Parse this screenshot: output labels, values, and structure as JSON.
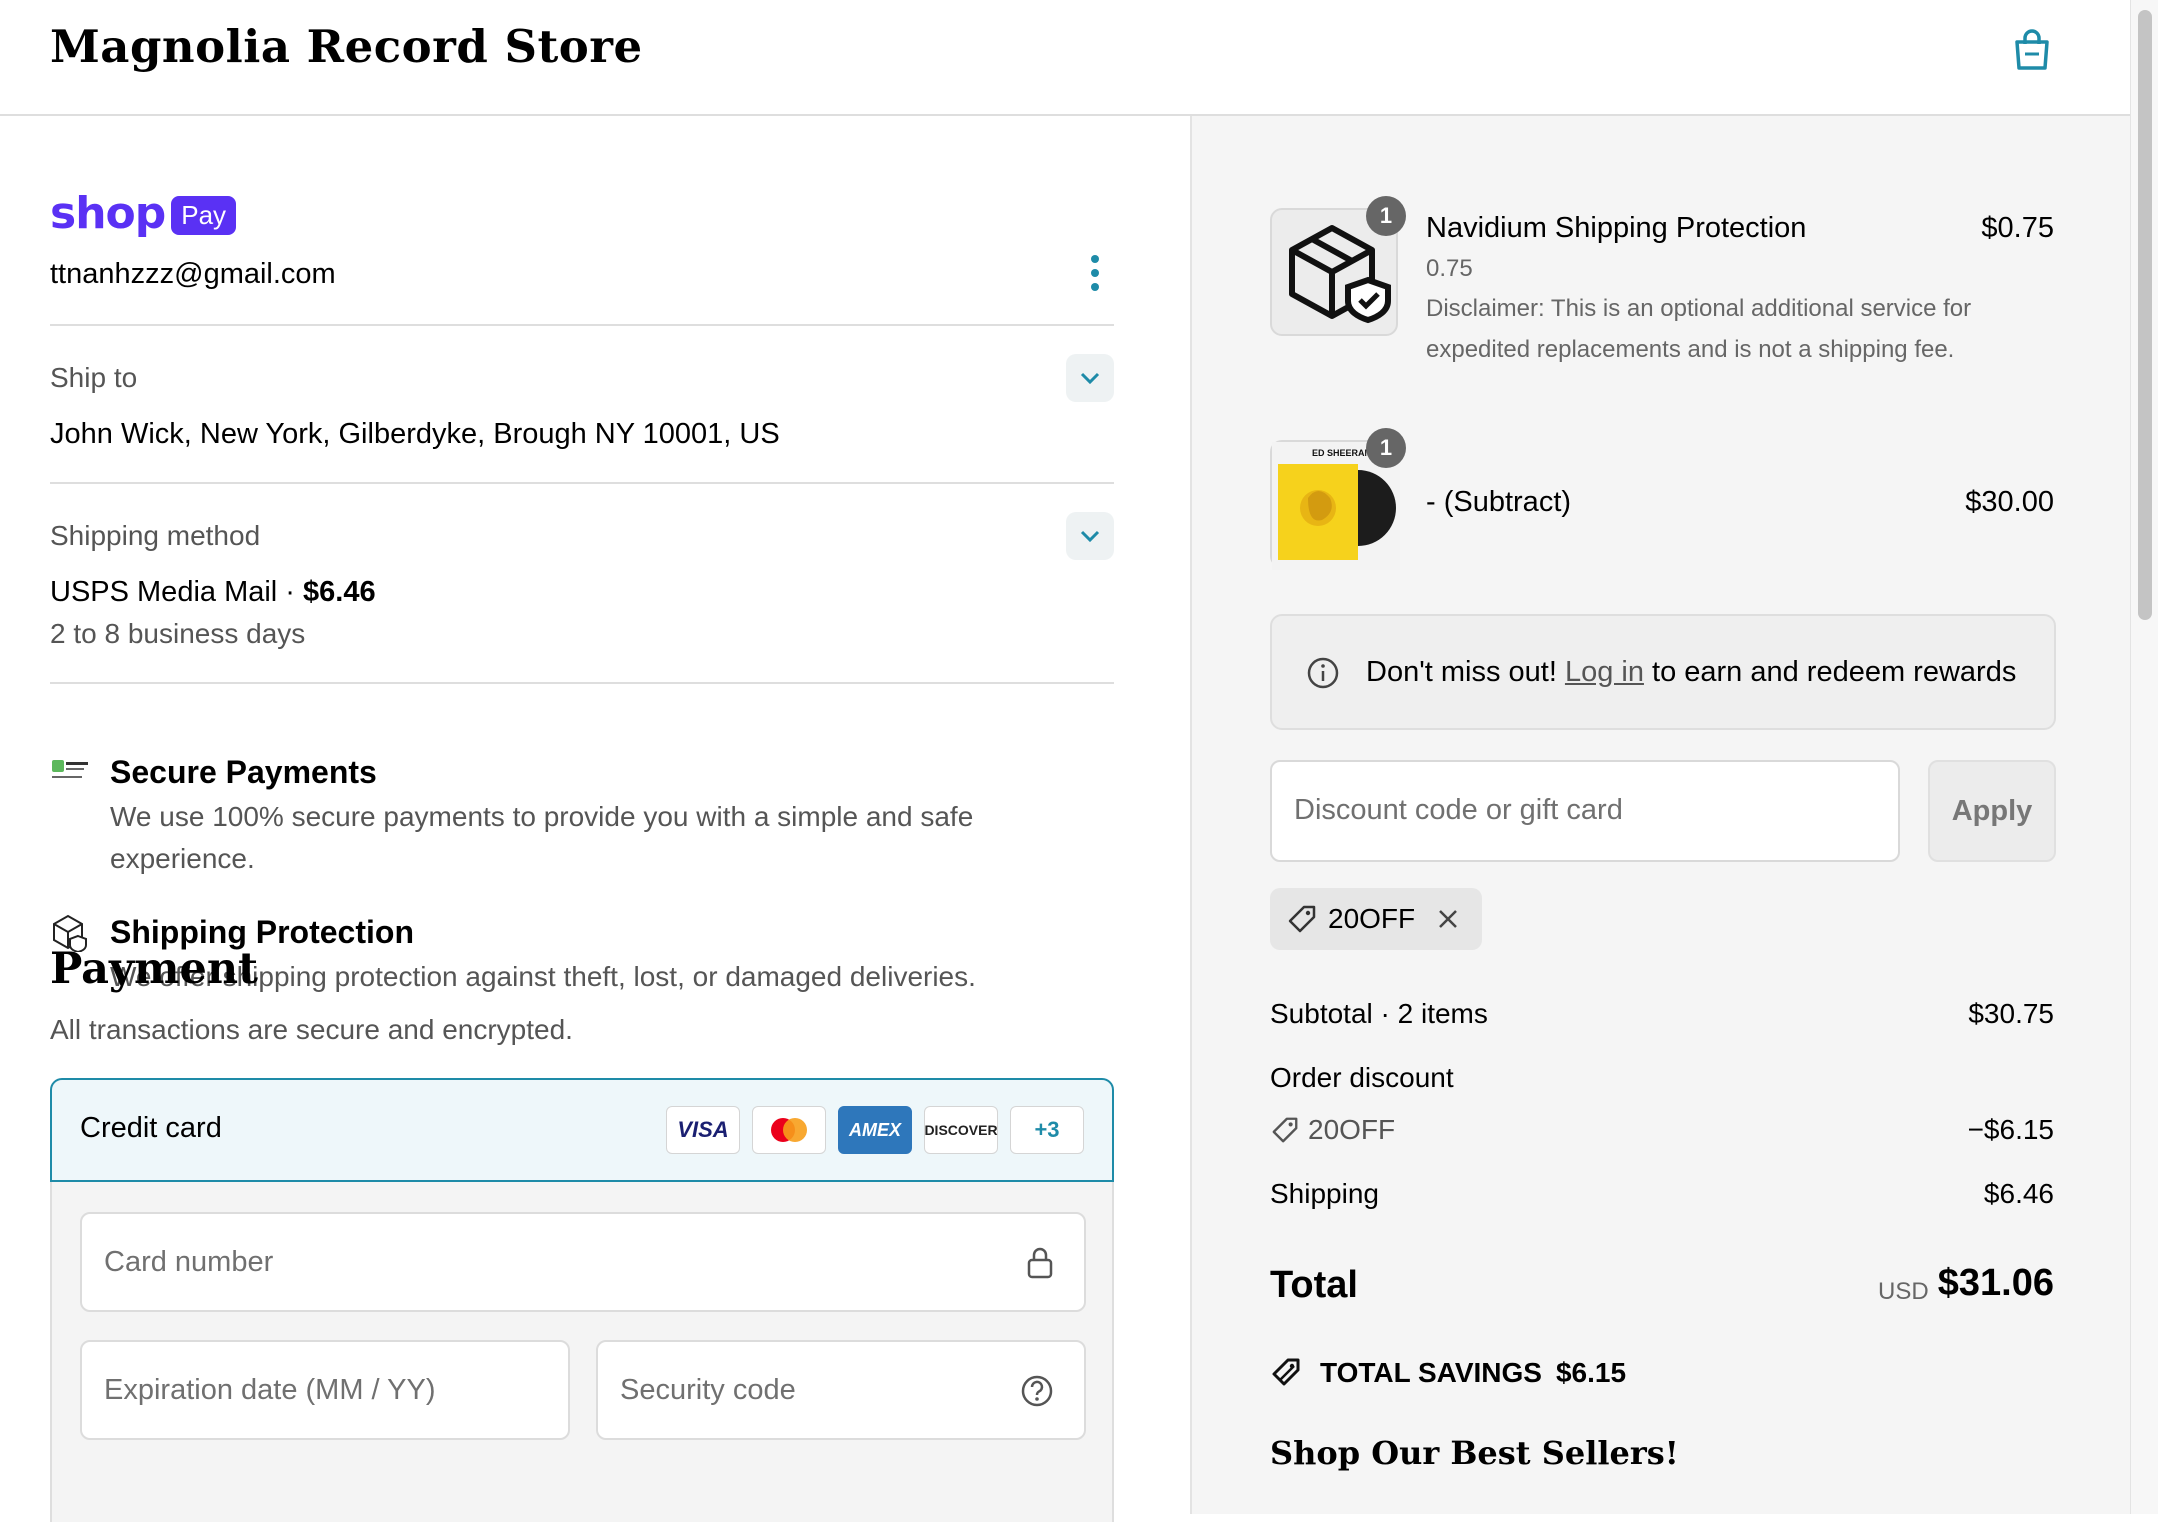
{
  "header": {
    "store_title": "Magnolia Record Store"
  },
  "shop_pay": {
    "shop_word": "shop",
    "pay_label": "Pay",
    "email": "ttnanhzzz@gmail.com"
  },
  "ship_to": {
    "label": "Ship to",
    "address": "John Wick, New York, Gilberdyke, Brough NY 10001, US"
  },
  "shipping_method": {
    "label": "Shipping method",
    "name": "USPS Media Mail",
    "sep": " · ",
    "price": "$6.46",
    "eta": "2 to 8 business days"
  },
  "features": [
    {
      "title": "Secure Payments",
      "desc": "We use 100% secure payments to provide you with a simple and safe experience."
    },
    {
      "title": "Shipping Protection",
      "desc": "We offer shipping protection against theft, lost, or damaged deliveries."
    }
  ],
  "payment": {
    "title": "Payment",
    "subtitle": "All transactions are secure and encrypted.",
    "credit_card_label": "Credit card",
    "card_brands": [
      "VISA",
      "mastercard",
      "AMEX",
      "DISCOVER"
    ],
    "more_cards": "+3",
    "card_number_placeholder": "Card number",
    "expiry_placeholder": "Expiration date (MM / YY)",
    "security_placeholder": "Security code"
  },
  "cart": {
    "items": [
      {
        "name": "Navidium Shipping Protection",
        "price": "$0.75",
        "qty": "1",
        "variant": "0.75",
        "disclaimer": "Disclaimer: This is an optional additional service for expedited replacements and is not a shipping fee."
      },
      {
        "name": "- (Subtract)",
        "price": "$30.00",
        "qty": "1",
        "album_artist": "ED SHEERAN"
      }
    ],
    "rewards": {
      "prefix": "Don't miss out! ",
      "link": "Log in",
      "suffix": " to earn and redeem rewards"
    },
    "discount_placeholder": "Discount code or gift card",
    "apply_label": "Apply",
    "applied_code": "20OFF",
    "summary": {
      "subtotal_label": "Subtotal · 2 items",
      "subtotal_value": "$30.75",
      "order_discount_label": "Order discount",
      "discount_code": "20OFF",
      "discount_value": "−$6.15",
      "shipping_label": "Shipping",
      "shipping_value": "$6.46",
      "total_label": "Total",
      "currency": "USD",
      "total_value": "$31.06",
      "savings_label": "TOTAL SAVINGS",
      "savings_value": "$6.15"
    },
    "best_sellers_heading": "Shop Our Best Sellers!"
  },
  "colors": {
    "shop_purple": "#5a31f4",
    "accent_teal": "#1e8ba8",
    "amex_blue": "#2e77bb"
  }
}
